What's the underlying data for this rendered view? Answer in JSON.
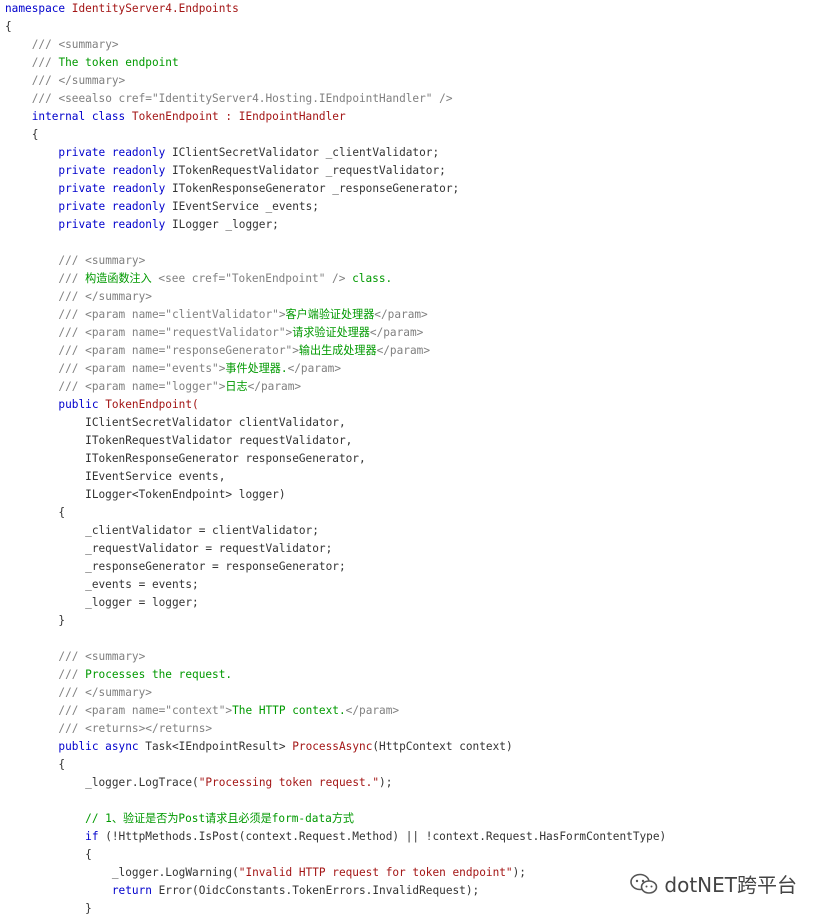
{
  "watermark": {
    "text": "dotNET跨平台",
    "icon": "wechat-icon"
  },
  "lines": [
    [
      {
        "t": "namespace ",
        "c": "kw"
      },
      {
        "t": "IdentityServer4.Endpoints",
        "c": "ty"
      }
    ],
    [
      {
        "t": "{",
        "c": "pl"
      }
    ],
    [
      {
        "t": "    /// ",
        "c": "ct"
      },
      {
        "t": "<summary>",
        "c": "ct"
      }
    ],
    [
      {
        "t": "    /// ",
        "c": "ct"
      },
      {
        "t": "The token endpoint",
        "c": "cm"
      }
    ],
    [
      {
        "t": "    /// ",
        "c": "ct"
      },
      {
        "t": "</summary>",
        "c": "ct"
      }
    ],
    [
      {
        "t": "    /// ",
        "c": "ct"
      },
      {
        "t": "<seealso cref=\"IdentityServer4.Hosting.IEndpointHandler\" />",
        "c": "ct"
      }
    ],
    [
      {
        "t": "    internal class ",
        "c": "kw"
      },
      {
        "t": "TokenEndpoint : IEndpointHandler",
        "c": "ty"
      }
    ],
    [
      {
        "t": "    {",
        "c": "pl"
      }
    ],
    [
      {
        "t": "        private readonly ",
        "c": "kw"
      },
      {
        "t": "IClientSecretValidator _clientValidator;",
        "c": "pl"
      }
    ],
    [
      {
        "t": "        private readonly ",
        "c": "kw"
      },
      {
        "t": "ITokenRequestValidator _requestValidator;",
        "c": "pl"
      }
    ],
    [
      {
        "t": "        private readonly ",
        "c": "kw"
      },
      {
        "t": "ITokenResponseGenerator _responseGenerator;",
        "c": "pl"
      }
    ],
    [
      {
        "t": "        private readonly ",
        "c": "kw"
      },
      {
        "t": "IEventService _events;",
        "c": "pl"
      }
    ],
    [
      {
        "t": "        private readonly ",
        "c": "kw"
      },
      {
        "t": "ILogger _logger;",
        "c": "pl"
      }
    ],
    [
      {
        "t": "",
        "c": "pl"
      }
    ],
    [
      {
        "t": "        /// ",
        "c": "ct"
      },
      {
        "t": "<summary>",
        "c": "ct"
      }
    ],
    [
      {
        "t": "        /// ",
        "c": "ct"
      },
      {
        "t": "构造函数注入 ",
        "c": "cm"
      },
      {
        "t": "<see cref=\"TokenEndpoint\" />",
        "c": "ct"
      },
      {
        "t": " class.",
        "c": "cm"
      }
    ],
    [
      {
        "t": "        /// ",
        "c": "ct"
      },
      {
        "t": "</summary>",
        "c": "ct"
      }
    ],
    [
      {
        "t": "        /// ",
        "c": "ct"
      },
      {
        "t": "<param name=\"clientValidator\">",
        "c": "ct"
      },
      {
        "t": "客户端验证处理器",
        "c": "cm"
      },
      {
        "t": "</param>",
        "c": "ct"
      }
    ],
    [
      {
        "t": "        /// ",
        "c": "ct"
      },
      {
        "t": "<param name=\"requestValidator\">",
        "c": "ct"
      },
      {
        "t": "请求验证处理器",
        "c": "cm"
      },
      {
        "t": "</param>",
        "c": "ct"
      }
    ],
    [
      {
        "t": "        /// ",
        "c": "ct"
      },
      {
        "t": "<param name=\"responseGenerator\">",
        "c": "ct"
      },
      {
        "t": "输出生成处理器",
        "c": "cm"
      },
      {
        "t": "</param>",
        "c": "ct"
      }
    ],
    [
      {
        "t": "        /// ",
        "c": "ct"
      },
      {
        "t": "<param name=\"events\">",
        "c": "ct"
      },
      {
        "t": "事件处理器.",
        "c": "cm"
      },
      {
        "t": "</param>",
        "c": "ct"
      }
    ],
    [
      {
        "t": "        /// ",
        "c": "ct"
      },
      {
        "t": "<param name=\"logger\">",
        "c": "ct"
      },
      {
        "t": "日志",
        "c": "cm"
      },
      {
        "t": "</param>",
        "c": "ct"
      }
    ],
    [
      {
        "t": "        public ",
        "c": "kw"
      },
      {
        "t": "TokenEndpoint(",
        "c": "ty"
      }
    ],
    [
      {
        "t": "            IClientSecretValidator clientValidator,",
        "c": "pl"
      }
    ],
    [
      {
        "t": "            ITokenRequestValidator requestValidator,",
        "c": "pl"
      }
    ],
    [
      {
        "t": "            ITokenResponseGenerator responseGenerator,",
        "c": "pl"
      }
    ],
    [
      {
        "t": "            IEventService events,",
        "c": "pl"
      }
    ],
    [
      {
        "t": "            ILogger<TokenEndpoint> logger)",
        "c": "pl"
      }
    ],
    [
      {
        "t": "        {",
        "c": "pl"
      }
    ],
    [
      {
        "t": "            _clientValidator = clientValidator;",
        "c": "pl"
      }
    ],
    [
      {
        "t": "            _requestValidator = requestValidator;",
        "c": "pl"
      }
    ],
    [
      {
        "t": "            _responseGenerator = responseGenerator;",
        "c": "pl"
      }
    ],
    [
      {
        "t": "            _events = events;",
        "c": "pl"
      }
    ],
    [
      {
        "t": "            _logger = logger;",
        "c": "pl"
      }
    ],
    [
      {
        "t": "        }",
        "c": "pl"
      }
    ],
    [
      {
        "t": "",
        "c": "pl"
      }
    ],
    [
      {
        "t": "        /// ",
        "c": "ct"
      },
      {
        "t": "<summary>",
        "c": "ct"
      }
    ],
    [
      {
        "t": "        /// ",
        "c": "ct"
      },
      {
        "t": "Processes the request.",
        "c": "cm"
      }
    ],
    [
      {
        "t": "        /// ",
        "c": "ct"
      },
      {
        "t": "</summary>",
        "c": "ct"
      }
    ],
    [
      {
        "t": "        /// ",
        "c": "ct"
      },
      {
        "t": "<param name=\"context\">",
        "c": "ct"
      },
      {
        "t": "The HTTP context.",
        "c": "cm"
      },
      {
        "t": "</param>",
        "c": "ct"
      }
    ],
    [
      {
        "t": "        /// ",
        "c": "ct"
      },
      {
        "t": "<returns></returns>",
        "c": "ct"
      }
    ],
    [
      {
        "t": "        public async ",
        "c": "kw"
      },
      {
        "t": "Task<IEndpointResult> ",
        "c": "pl"
      },
      {
        "t": "ProcessAsync",
        "c": "ty"
      },
      {
        "t": "(HttpContext context)",
        "c": "pl"
      }
    ],
    [
      {
        "t": "        {",
        "c": "pl"
      }
    ],
    [
      {
        "t": "            _logger.LogTrace(",
        "c": "pl"
      },
      {
        "t": "\"Processing token request.\"",
        "c": "st"
      },
      {
        "t": ");",
        "c": "pl"
      }
    ],
    [
      {
        "t": "",
        "c": "pl"
      }
    ],
    [
      {
        "t": "            // 1、验证是否为Post请求且必须是form-data方式",
        "c": "cm"
      }
    ],
    [
      {
        "t": "            if ",
        "c": "kw"
      },
      {
        "t": "(!HttpMethods.IsPost(context.Request.Method) || !context.Request.HasFormContentType)",
        "c": "pl"
      }
    ],
    [
      {
        "t": "            {",
        "c": "pl"
      }
    ],
    [
      {
        "t": "                _logger.LogWarning(",
        "c": "pl"
      },
      {
        "t": "\"Invalid HTTP request for token endpoint\"",
        "c": "st"
      },
      {
        "t": ");",
        "c": "pl"
      }
    ],
    [
      {
        "t": "                return ",
        "c": "kw"
      },
      {
        "t": "Error(OidcConstants.TokenErrors.InvalidRequest);",
        "c": "pl"
      }
    ],
    [
      {
        "t": "            }",
        "c": "pl"
      }
    ]
  ]
}
